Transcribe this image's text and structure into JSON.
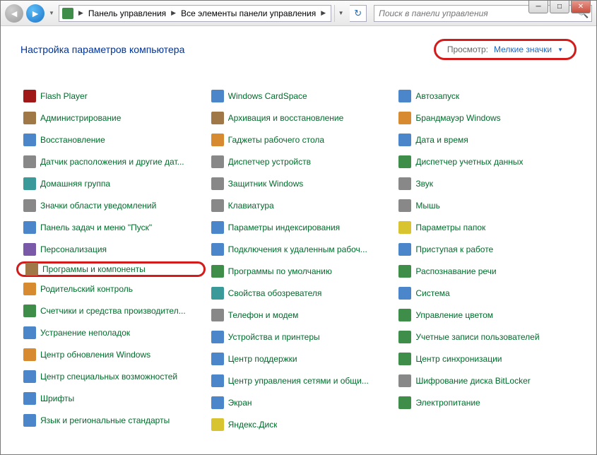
{
  "breadcrumb": {
    "seg1": "Панель управления",
    "seg2": "Все элементы панели управления"
  },
  "search": {
    "placeholder": "Поиск в панели управления"
  },
  "page_title": "Настройка параметров компьютера",
  "view": {
    "label": "Просмотр:",
    "value": "Мелкие значки"
  },
  "items": {
    "col1": [
      "Flash Player",
      "Администрирование",
      "Восстановление",
      "Датчик расположения и другие дат...",
      "Домашняя группа",
      "Значки области уведомлений",
      "Панель задач и меню \"Пуск\"",
      "Персонализация",
      "Программы и компоненты",
      "Родительский контроль",
      "Счетчики и средства производител...",
      "Устранение неполадок",
      "Центр обновления Windows",
      "Центр специальных возможностей",
      "Шрифты",
      "Язык и региональные стандарты"
    ],
    "col2": [
      "Windows CardSpace",
      "Архивация и восстановление",
      "Гаджеты рабочего стола",
      "Диспетчер устройств",
      "Защитник Windows",
      "Клавиатура",
      "Параметры индексирования",
      "Подключения к удаленным рабоч...",
      "Программы по умолчанию",
      "Свойства обозревателя",
      "Телефон и модем",
      "Устройства и принтеры",
      "Центр поддержки",
      "Центр управления сетями и общи...",
      "Экран",
      "Яндекс.Диск"
    ],
    "col3": [
      "Автозапуск",
      "Брандмауэр Windows",
      "Дата и время",
      "Диспетчер учетных данных",
      "Звук",
      "Мышь",
      "Параметры папок",
      "Приступая к работе",
      "Распознавание речи",
      "Система",
      "Управление цветом",
      "Учетные записи пользователей",
      "Центр синхронизации",
      "Шифрование диска BitLocker",
      "Электропитание"
    ]
  },
  "icon_colors": {
    "col1": [
      "ic-red",
      "ic-brown",
      "ic-blue",
      "ic-gray",
      "ic-teal",
      "ic-gray",
      "ic-blue",
      "ic-purple",
      "ic-brown",
      "ic-orange",
      "ic-green",
      "ic-blue",
      "ic-orange",
      "ic-blue",
      "ic-blue",
      "ic-blue"
    ],
    "col2": [
      "ic-blue",
      "ic-brown",
      "ic-orange",
      "ic-gray",
      "ic-gray",
      "ic-gray",
      "ic-blue",
      "ic-blue",
      "ic-green",
      "ic-teal",
      "ic-gray",
      "ic-blue",
      "ic-blue",
      "ic-blue",
      "ic-blue",
      "ic-yellow"
    ],
    "col3": [
      "ic-blue",
      "ic-orange",
      "ic-blue",
      "ic-green",
      "ic-gray",
      "ic-gray",
      "ic-yellow",
      "ic-blue",
      "ic-green",
      "ic-blue",
      "ic-green",
      "ic-green",
      "ic-green",
      "ic-gray",
      "ic-green"
    ]
  },
  "highlight": {
    "col": "col1",
    "index": 8
  }
}
